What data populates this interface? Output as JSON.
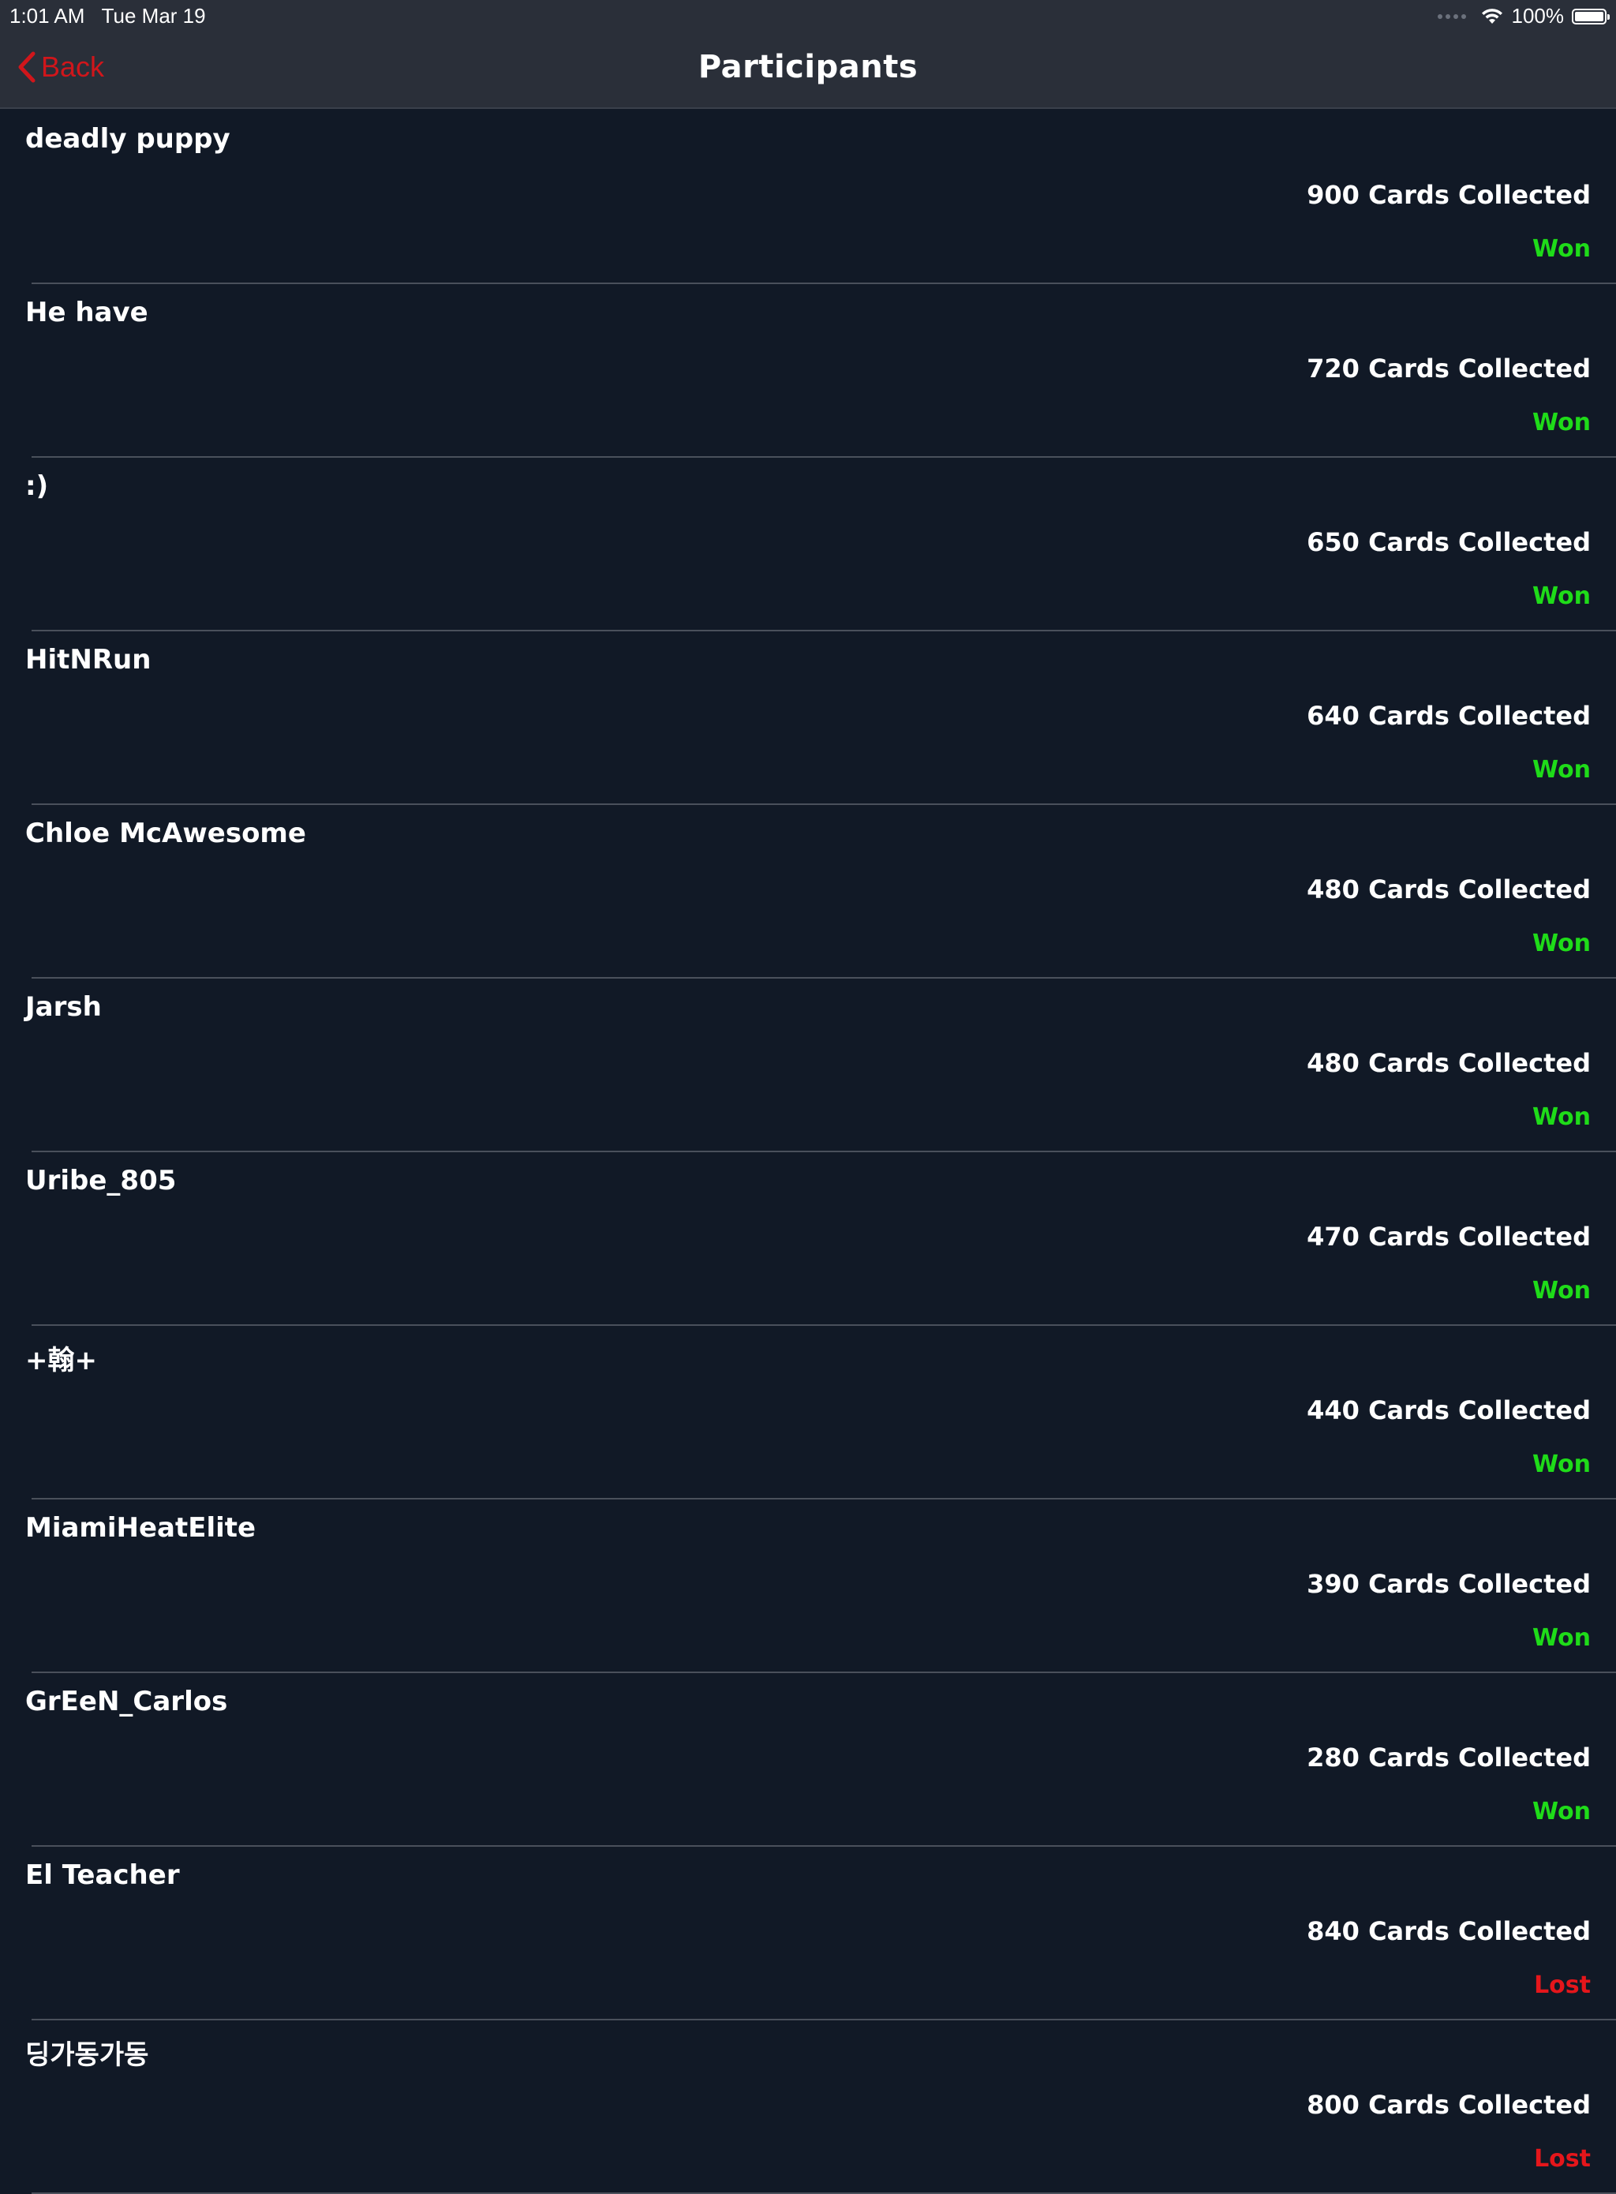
{
  "status_bar": {
    "time": "1:01 AM",
    "date": "Tue Mar 19",
    "battery": "100%"
  },
  "nav": {
    "back_label": "Back",
    "title": "Participants"
  },
  "participants": [
    {
      "name": "deadly puppy",
      "cards": "900 Cards Collected",
      "result": "Won"
    },
    {
      "name": "He have",
      "cards": "720 Cards Collected",
      "result": "Won"
    },
    {
      "name": ":)",
      "cards": "650 Cards Collected",
      "result": "Won"
    },
    {
      "name": "HitNRun",
      "cards": "640 Cards Collected",
      "result": "Won"
    },
    {
      "name": "Chloe McAwesome",
      "cards": "480 Cards Collected",
      "result": "Won"
    },
    {
      "name": "Jarsh",
      "cards": "480 Cards Collected",
      "result": "Won"
    },
    {
      "name": "Uribe_805",
      "cards": "470 Cards Collected",
      "result": "Won"
    },
    {
      "name": "+翰+",
      "cards": "440 Cards Collected",
      "result": "Won"
    },
    {
      "name": "MiamiHeatElite",
      "cards": "390 Cards Collected",
      "result": "Won"
    },
    {
      "name": "GrEeN_Carlos",
      "cards": "280 Cards Collected",
      "result": "Won"
    },
    {
      "name": "El Teacher",
      "cards": "840 Cards Collected",
      "result": "Lost"
    },
    {
      "name": "딩가동가동",
      "cards": "800 Cards Collected",
      "result": "Lost"
    }
  ],
  "colors": {
    "won": "#1fdc19",
    "lost": "#e5161b",
    "accent": "#d0161b",
    "background": "#111926",
    "bar": "#2a2f39"
  }
}
